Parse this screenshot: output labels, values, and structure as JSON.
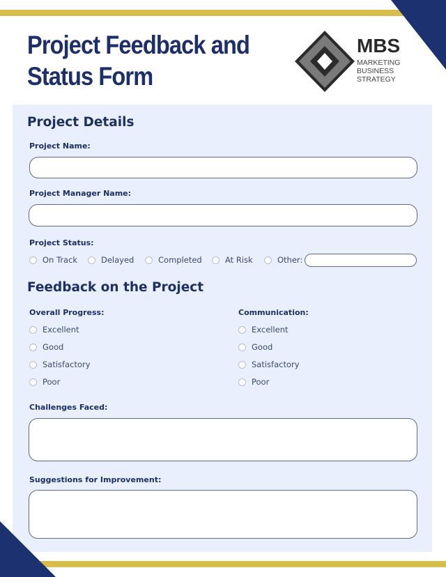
{
  "document": {
    "title_line1": "Project Feedback and",
    "title_line2": "Status Form",
    "colors": {
      "navy": "#1c3170",
      "gold": "#d9bd4b",
      "panel": "#e9effd"
    }
  },
  "logo": {
    "acronym": "MBS",
    "line1": "MARKETING",
    "line2": "BUSINESS",
    "line3": "STRATEGY"
  },
  "project_details": {
    "heading": "Project Details",
    "project_name_label": "Project Name:",
    "project_name_value": "",
    "manager_label": "Project Manager Name:",
    "manager_value": "",
    "status_label": "Project Status:",
    "status_options": [
      "On Track",
      "Delayed",
      "Completed",
      "At Risk",
      "Other:"
    ],
    "other_value": ""
  },
  "feedback": {
    "heading": "Feedback on the Project",
    "overall_progress": {
      "label": "Overall Progress:",
      "options": [
        "Excellent",
        "Good",
        "Satisfactory",
        "Poor"
      ]
    },
    "communication": {
      "label": "Communication:",
      "options": [
        "Excellent",
        "Good",
        "Satisfactory",
        "Poor"
      ]
    },
    "challenges_label": "Challenges Faced:",
    "challenges_value": "",
    "suggestions_label": "Suggestions for Improvement:",
    "suggestions_value": ""
  }
}
